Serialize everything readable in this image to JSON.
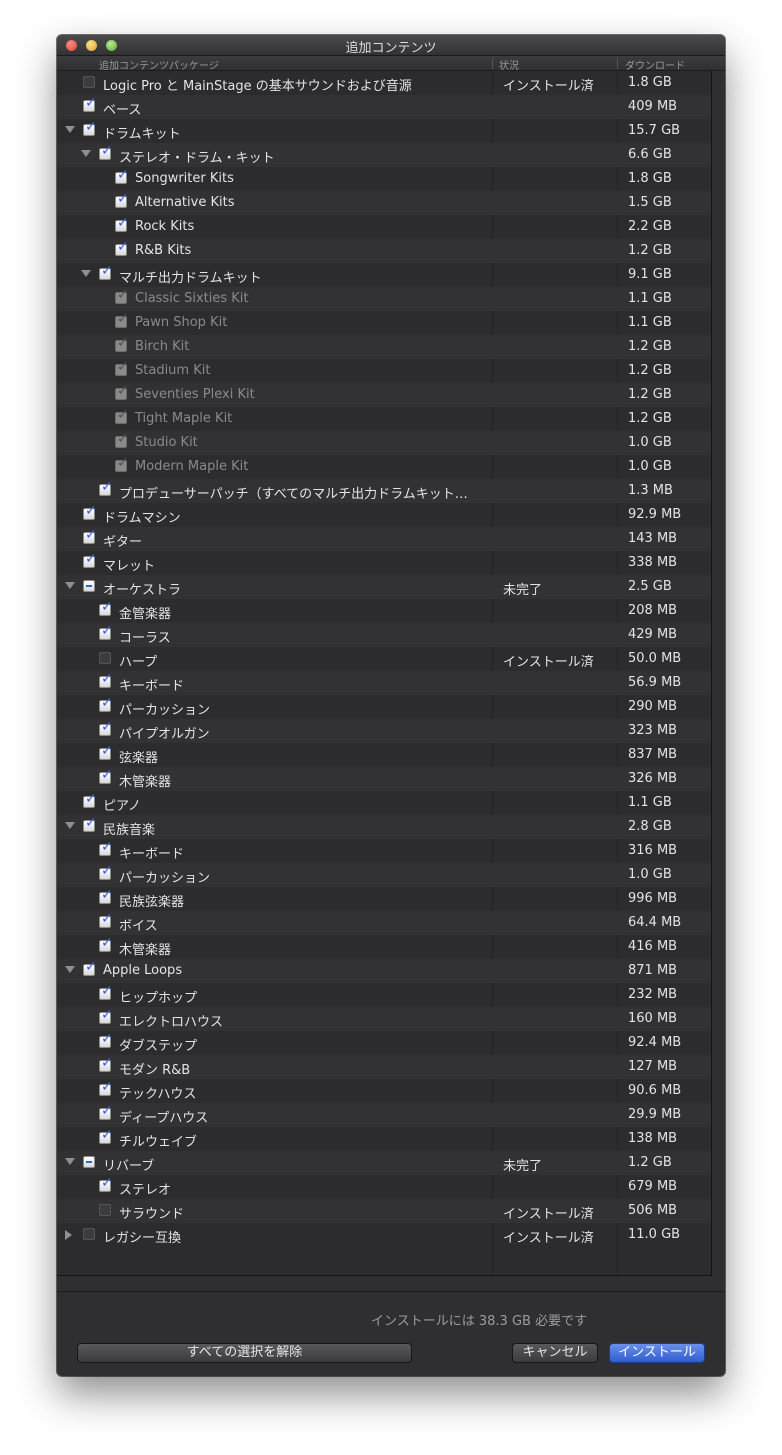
{
  "window": {
    "title": "追加コンテンツ"
  },
  "columns": {
    "package": "追加コンテンツパッケージ",
    "status": "状況",
    "download": "ダウンロード"
  },
  "rows": [
    {
      "level": 0,
      "expander": "none",
      "check": "unchecked",
      "dim": false,
      "label": "Logic Pro と MainStage の基本サウンドおよび音源",
      "status": "インストール済",
      "size": "1.8 GB"
    },
    {
      "level": 0,
      "expander": "none",
      "check": "checked",
      "dim": false,
      "label": "ベース",
      "status": "",
      "size": "409 MB"
    },
    {
      "level": 0,
      "expander": "open",
      "check": "checked",
      "dim": false,
      "label": "ドラムキット",
      "status": "",
      "size": "15.7 GB"
    },
    {
      "level": 1,
      "expander": "open",
      "check": "checked",
      "dim": false,
      "label": "ステレオ・ドラム・キット",
      "status": "",
      "size": "6.6 GB"
    },
    {
      "level": 2,
      "expander": "none",
      "check": "checked",
      "dim": false,
      "label": "Songwriter Kits",
      "status": "",
      "size": "1.8 GB"
    },
    {
      "level": 2,
      "expander": "none",
      "check": "checked",
      "dim": false,
      "label": "Alternative Kits",
      "status": "",
      "size": "1.5 GB"
    },
    {
      "level": 2,
      "expander": "none",
      "check": "checked",
      "dim": false,
      "label": "Rock Kits",
      "status": "",
      "size": "2.2 GB"
    },
    {
      "level": 2,
      "expander": "none",
      "check": "checked",
      "dim": false,
      "label": "R&B Kits",
      "status": "",
      "size": "1.2 GB"
    },
    {
      "level": 1,
      "expander": "open",
      "check": "checked",
      "dim": false,
      "label": "マルチ出力ドラムキット",
      "status": "",
      "size": "9.1 GB"
    },
    {
      "level": 2,
      "expander": "none",
      "check": "checked",
      "dim": true,
      "label": "Classic Sixties Kit",
      "status": "",
      "size": "1.1 GB"
    },
    {
      "level": 2,
      "expander": "none",
      "check": "checked",
      "dim": true,
      "label": "Pawn Shop Kit",
      "status": "",
      "size": "1.1 GB"
    },
    {
      "level": 2,
      "expander": "none",
      "check": "checked",
      "dim": true,
      "label": "Birch Kit",
      "status": "",
      "size": "1.2 GB"
    },
    {
      "level": 2,
      "expander": "none",
      "check": "checked",
      "dim": true,
      "label": "Stadium Kit",
      "status": "",
      "size": "1.2 GB"
    },
    {
      "level": 2,
      "expander": "none",
      "check": "checked",
      "dim": true,
      "label": "Seventies Plexi Kit",
      "status": "",
      "size": "1.2 GB"
    },
    {
      "level": 2,
      "expander": "none",
      "check": "checked",
      "dim": true,
      "label": "Tight Maple Kit",
      "status": "",
      "size": "1.2 GB"
    },
    {
      "level": 2,
      "expander": "none",
      "check": "checked",
      "dim": true,
      "label": "Studio Kit",
      "status": "",
      "size": "1.0 GB"
    },
    {
      "level": 2,
      "expander": "none",
      "check": "checked",
      "dim": true,
      "label": "Modern Maple Kit",
      "status": "",
      "size": "1.0 GB"
    },
    {
      "level": 1,
      "expander": "none",
      "check": "checked",
      "dim": false,
      "label": "プロデューサーパッチ（すべてのマルチ出力ドラムキット…",
      "status": "",
      "size": "1.3 MB"
    },
    {
      "level": 0,
      "expander": "none",
      "check": "checked",
      "dim": false,
      "label": "ドラムマシン",
      "status": "",
      "size": "92.9 MB"
    },
    {
      "level": 0,
      "expander": "none",
      "check": "checked",
      "dim": false,
      "label": "ギター",
      "status": "",
      "size": "143 MB"
    },
    {
      "level": 0,
      "expander": "none",
      "check": "checked",
      "dim": false,
      "label": "マレット",
      "status": "",
      "size": "338 MB"
    },
    {
      "level": 0,
      "expander": "open",
      "check": "mixed",
      "dim": false,
      "label": "オーケストラ",
      "status": "未完了",
      "size": "2.5 GB"
    },
    {
      "level": 1,
      "expander": "none",
      "check": "checked",
      "dim": false,
      "label": "金管楽器",
      "status": "",
      "size": "208 MB"
    },
    {
      "level": 1,
      "expander": "none",
      "check": "checked",
      "dim": false,
      "label": "コーラス",
      "status": "",
      "size": "429 MB"
    },
    {
      "level": 1,
      "expander": "none",
      "check": "unchecked",
      "dim": false,
      "label": "ハープ",
      "status": "インストール済",
      "size": "50.0 MB"
    },
    {
      "level": 1,
      "expander": "none",
      "check": "checked",
      "dim": false,
      "label": "キーボード",
      "status": "",
      "size": "56.9 MB"
    },
    {
      "level": 1,
      "expander": "none",
      "check": "checked",
      "dim": false,
      "label": "パーカッション",
      "status": "",
      "size": "290 MB"
    },
    {
      "level": 1,
      "expander": "none",
      "check": "checked",
      "dim": false,
      "label": "パイプオルガン",
      "status": "",
      "size": "323 MB"
    },
    {
      "level": 1,
      "expander": "none",
      "check": "checked",
      "dim": false,
      "label": "弦楽器",
      "status": "",
      "size": "837 MB"
    },
    {
      "level": 1,
      "expander": "none",
      "check": "checked",
      "dim": false,
      "label": "木管楽器",
      "status": "",
      "size": "326 MB"
    },
    {
      "level": 0,
      "expander": "none",
      "check": "checked",
      "dim": false,
      "label": "ピアノ",
      "status": "",
      "size": "1.1 GB"
    },
    {
      "level": 0,
      "expander": "open",
      "check": "checked",
      "dim": false,
      "label": "民族音楽",
      "status": "",
      "size": "2.8 GB"
    },
    {
      "level": 1,
      "expander": "none",
      "check": "checked",
      "dim": false,
      "label": "キーボード",
      "status": "",
      "size": "316 MB"
    },
    {
      "level": 1,
      "expander": "none",
      "check": "checked",
      "dim": false,
      "label": "パーカッション",
      "status": "",
      "size": "1.0 GB"
    },
    {
      "level": 1,
      "expander": "none",
      "check": "checked",
      "dim": false,
      "label": "民族弦楽器",
      "status": "",
      "size": "996 MB"
    },
    {
      "level": 1,
      "expander": "none",
      "check": "checked",
      "dim": false,
      "label": "ボイス",
      "status": "",
      "size": "64.4 MB"
    },
    {
      "level": 1,
      "expander": "none",
      "check": "checked",
      "dim": false,
      "label": "木管楽器",
      "status": "",
      "size": "416 MB"
    },
    {
      "level": 0,
      "expander": "open",
      "check": "checked",
      "dim": false,
      "label": "Apple Loops",
      "status": "",
      "size": "871 MB"
    },
    {
      "level": 1,
      "expander": "none",
      "check": "checked",
      "dim": false,
      "label": "ヒップホップ",
      "status": "",
      "size": "232 MB"
    },
    {
      "level": 1,
      "expander": "none",
      "check": "checked",
      "dim": false,
      "label": "エレクトロハウス",
      "status": "",
      "size": "160 MB"
    },
    {
      "level": 1,
      "expander": "none",
      "check": "checked",
      "dim": false,
      "label": "ダブステップ",
      "status": "",
      "size": "92.4 MB"
    },
    {
      "level": 1,
      "expander": "none",
      "check": "checked",
      "dim": false,
      "label": "モダン R&B",
      "status": "",
      "size": "127 MB"
    },
    {
      "level": 1,
      "expander": "none",
      "check": "checked",
      "dim": false,
      "label": "テックハウス",
      "status": "",
      "size": "90.6 MB"
    },
    {
      "level": 1,
      "expander": "none",
      "check": "checked",
      "dim": false,
      "label": "ディープハウス",
      "status": "",
      "size": "29.9 MB"
    },
    {
      "level": 1,
      "expander": "none",
      "check": "checked",
      "dim": false,
      "label": "チルウェイブ",
      "status": "",
      "size": "138 MB"
    },
    {
      "level": 0,
      "expander": "open",
      "check": "mixed",
      "dim": false,
      "label": "リバーブ",
      "status": "未完了",
      "size": "1.2 GB"
    },
    {
      "level": 1,
      "expander": "none",
      "check": "checked",
      "dim": false,
      "label": "ステレオ",
      "status": "",
      "size": "679 MB"
    },
    {
      "level": 1,
      "expander": "none",
      "check": "unchecked",
      "dim": false,
      "label": "サラウンド",
      "status": "インストール済",
      "size": "506 MB"
    },
    {
      "level": 0,
      "expander": "closed",
      "check": "unchecked",
      "dim": false,
      "label": "レガシー互換",
      "status": "インストール済",
      "size": "11.0 GB"
    }
  ],
  "footer": {
    "requirement": "インストールには 38.3 GB 必要です",
    "deselect_all_label": "すべての選択を解除",
    "cancel_label": "キャンセル",
    "install_label": "インストール"
  },
  "colors": {
    "accent": "#2f62d8",
    "window_bg": "#2f2f31",
    "row_alt": "#323234"
  }
}
